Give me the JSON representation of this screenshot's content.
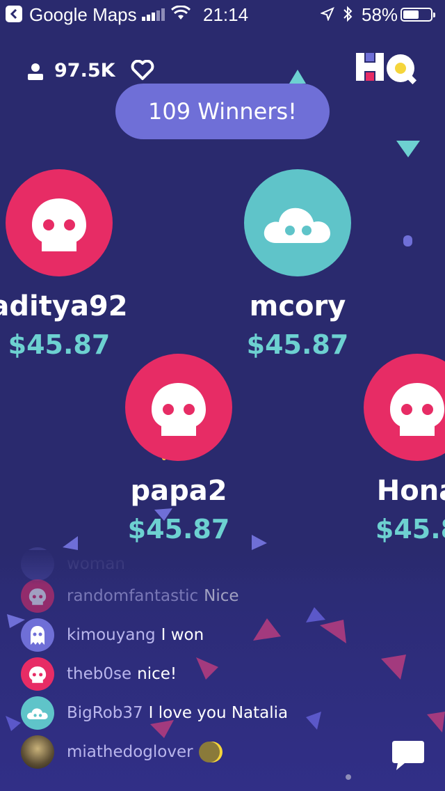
{
  "status_bar": {
    "carrier": "Google Maps",
    "time": "21:14",
    "battery": "58%",
    "battery_level": 0.58
  },
  "header": {
    "viewer_count": "97.5K",
    "logo_text": "HQ",
    "winners_banner": "109 Winners!"
  },
  "winners": [
    {
      "name": "aditya92",
      "prize": "$45.87",
      "avatar": "skull-icon",
      "color": "#e72c65"
    },
    {
      "name": "mcory",
      "prize": "$45.87",
      "avatar": "cloud-icon",
      "color": "#5fc4c9"
    },
    {
      "name": "papa2",
      "prize": "$45.87",
      "avatar": "skull-icon",
      "color": "#e72c65"
    },
    {
      "name": "Hona",
      "prize": "$45.8",
      "avatar": "skull-icon",
      "color": "#e72c65"
    }
  ],
  "chat": {
    "messages": [
      {
        "user": "woman",
        "text": "",
        "avatar": "faded"
      },
      {
        "user": "randomfantastic",
        "text": "Nice",
        "avatar": "skull-icon"
      },
      {
        "user": "kimouyang",
        "text": "I won",
        "avatar": "ghost-icon"
      },
      {
        "user": "theb0se",
        "text": "nice!",
        "avatar": "skull-icon"
      },
      {
        "user": "BigRob37",
        "text": "I love you Natalia",
        "avatar": "cloud-icon"
      },
      {
        "user": "miathedoglover",
        "text": "",
        "avatar": "photo",
        "emoji": "moon-icon"
      }
    ]
  },
  "colors": {
    "background": "#2a2a6e",
    "accent_purple": "#6f6fd7",
    "prize_teal": "#6dd1d1",
    "red": "#e72c65",
    "teal": "#5fc4c9"
  }
}
